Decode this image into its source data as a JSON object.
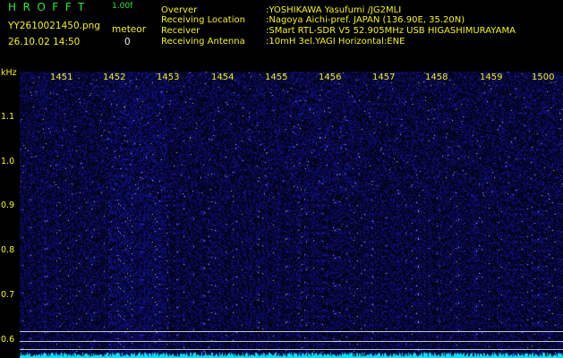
{
  "header": {
    "app_name": "HROFFT",
    "version": "1.00f",
    "filename": "YY2610021450.png",
    "meteor_label": "meteor",
    "datetime": "26.10.02 14:50",
    "meteor_count": "0",
    "info": [
      {
        "label": "Overver",
        "value": ":YOSHIKAWA Yasufumi /JG2MLI"
      },
      {
        "label": "Receiving Location",
        "value": ":Nagoya Aichi-pref. JAPAN (136.90E, 35.20N)"
      },
      {
        "label": "Receiver",
        "value": ":SMart RTL-SDR V5 52.905MHz USB HIGASHIMURAYAMA"
      },
      {
        "label": "Receiving Antenna",
        "value": ":10mH 3el.YAGI Horizontal:ENE"
      }
    ]
  },
  "axis": {
    "unit": "kHz",
    "time_ticks": [
      "1451",
      "1452",
      "1453",
      "1454",
      "1455",
      "1456",
      "1457",
      "1458",
      "1459",
      "1500"
    ],
    "freq_ticks": [
      "1.1",
      "1.0",
      "0.9",
      "0.8",
      "0.7",
      "0.6"
    ]
  },
  "colors": {
    "background": "#000000",
    "noise": "#1a1aa0",
    "spectrum": "#00e5ff",
    "text_green": "#2ee82e",
    "text_yellow": "#f4f400"
  }
}
